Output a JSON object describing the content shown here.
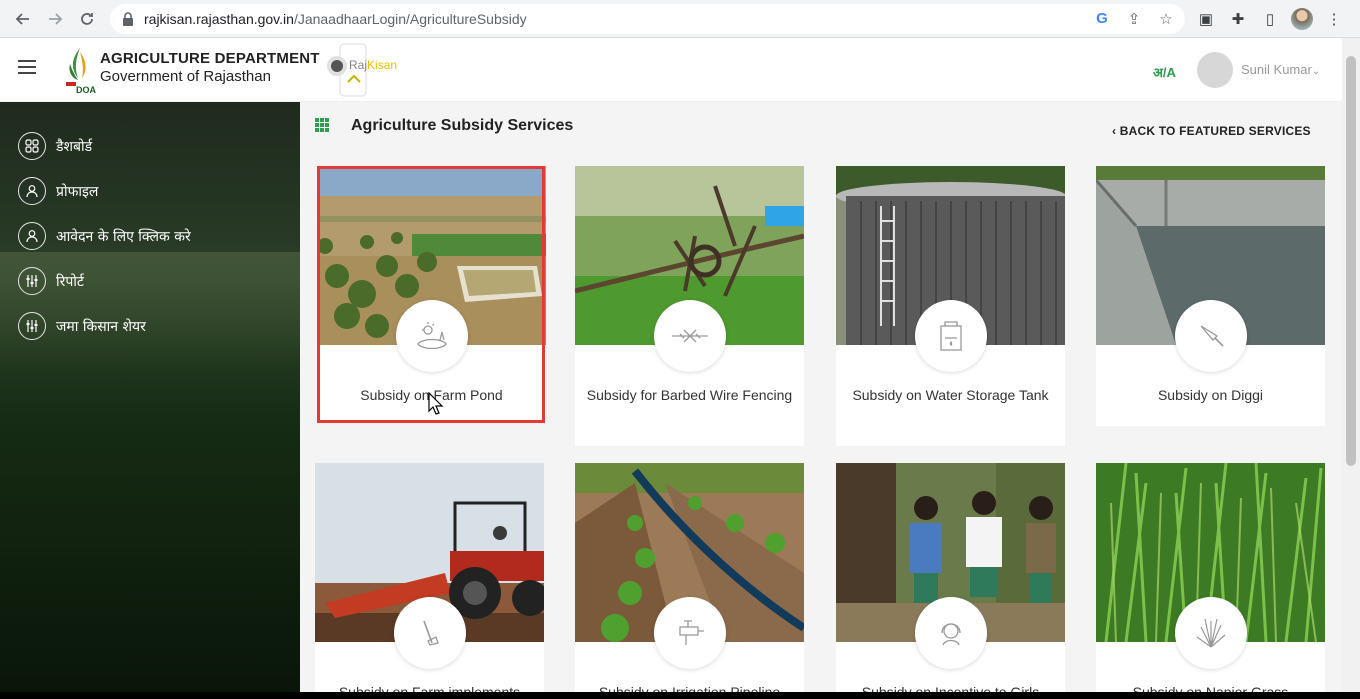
{
  "browser": {
    "url_domain": "rajkisan.rajasthan.gov.in",
    "url_path": "/JanaadhaarLogin/AgricultureSubsidy"
  },
  "header": {
    "dept_title": "AGRICULTURE DEPARTMENT",
    "dept_subtitle": "Government of Rajasthan",
    "logo_small_text": "DOA",
    "rajkisan_prefix": "Raj",
    "rajkisan_suffix": "Kisan",
    "lang_toggle": "अ/A",
    "user_name": "Sunil Kumar"
  },
  "sidebar": {
    "items": [
      {
        "label": "डैशबोर्ड",
        "icon": "dashboard-icon"
      },
      {
        "label": "प्रोफाइल",
        "icon": "user-icon"
      },
      {
        "label": "आवेदन के लिए क्लिक करे",
        "icon": "user-icon"
      },
      {
        "label": "रिपोर्ट",
        "icon": "sliders-icon"
      },
      {
        "label": "जमा किसान शेयर",
        "icon": "sliders-icon"
      }
    ]
  },
  "main": {
    "page_title": "Agriculture Subsidy Services",
    "back_link": "‹ BACK TO FEATURED SERVICES",
    "cards": [
      {
        "title": "Subsidy on Farm Pond",
        "icon": "farm-pond-icon",
        "highlighted": true
      },
      {
        "title": "Subsidy for Barbed Wire Fencing",
        "icon": "barbed-wire-icon"
      },
      {
        "title": "Subsidy on Water Storage Tank",
        "icon": "water-tank-icon"
      },
      {
        "title": "Subsidy on Diggi",
        "icon": "trowel-icon"
      },
      {
        "title": "Subsidy on Farm implements",
        "icon": "hoe-icon"
      },
      {
        "title": "Subsidy on Irrigation Pipeline",
        "icon": "pipe-tap-icon"
      },
      {
        "title": "Subsidy on Incentive to Girls",
        "icon": "girl-icon"
      },
      {
        "title": "Subsidy on Napier Grass",
        "icon": "grass-icon"
      }
    ]
  }
}
